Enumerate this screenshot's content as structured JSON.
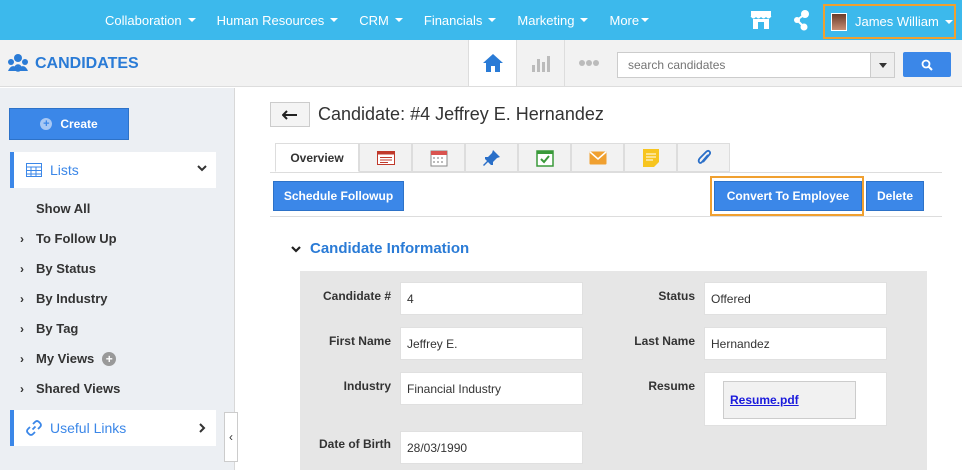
{
  "topnav": {
    "menu": [
      {
        "label": "Collaboration"
      },
      {
        "label": "Human Resources"
      },
      {
        "label": "CRM"
      },
      {
        "label": "Financials"
      },
      {
        "label": "Marketing"
      },
      {
        "label": "More"
      }
    ],
    "user_name": "James William",
    "icons": [
      "store-icon",
      "connect-icon"
    ]
  },
  "subheader": {
    "title": "CANDIDATES",
    "search_placeholder": "search candidates"
  },
  "sidebar": {
    "create_label": "Create",
    "lists_label": "Lists",
    "items": [
      {
        "label": "Show All"
      },
      {
        "label": "To Follow Up"
      },
      {
        "label": "By Status"
      },
      {
        "label": "By Industry"
      },
      {
        "label": "By Tag"
      },
      {
        "label": "My Views"
      },
      {
        "label": "Shared Views"
      }
    ],
    "useful_links_label": "Useful Links"
  },
  "main": {
    "title": "Candidate: #4 Jeffrey E. Hernandez",
    "active_tab": "Overview",
    "buttons": {
      "schedule": "Schedule Followup",
      "convert": "Convert To Employee",
      "delete": "Delete"
    },
    "section_title": "Candidate Information",
    "fields": {
      "candidate_no_label": "Candidate #",
      "candidate_no_value": "4",
      "status_label": "Status",
      "status_value": "Offered",
      "first_name_label": "First Name",
      "first_name_value": "Jeffrey E.",
      "last_name_label": "Last Name",
      "last_name_value": "Hernandez",
      "industry_label": "Industry",
      "industry_value": "Financial Industry",
      "resume_label": "Resume",
      "resume_value": "Resume.pdf",
      "dob_label": "Date of Birth",
      "dob_value": "28/03/1990"
    }
  },
  "colors": {
    "topbar": "#3cb9ec",
    "accent": "#3b87e8",
    "highlight": "#f0a030"
  }
}
